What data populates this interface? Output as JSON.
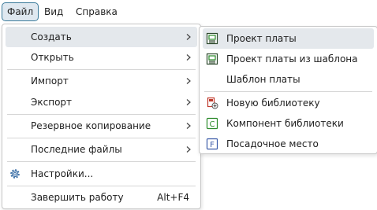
{
  "menubar": {
    "items": [
      {
        "label": "Файл"
      },
      {
        "label": "Вид"
      },
      {
        "label": "Справка"
      }
    ]
  },
  "file_menu": {
    "items": [
      {
        "label": "Создать"
      },
      {
        "label": "Открыть"
      },
      {
        "label": "Импорт"
      },
      {
        "label": "Экспорт"
      },
      {
        "label": "Резервное копирование"
      },
      {
        "label": "Последние файлы"
      },
      {
        "label": "Настройки..."
      },
      {
        "label": "Завершить работу",
        "shortcut": "Alt+F4"
      }
    ]
  },
  "create_submenu": {
    "items": [
      {
        "label": "Проект платы",
        "icon": "board-project-icon"
      },
      {
        "label": "Проект платы из шаблона",
        "icon": "board-template-icon"
      },
      {
        "label": "Шаблон платы"
      },
      {
        "label": "Новую библиотеку",
        "icon": "new-library-icon"
      },
      {
        "label": "Компонент библиотеки",
        "icon": "component-icon"
      },
      {
        "label": "Посадочное место",
        "icon": "footprint-icon"
      }
    ]
  },
  "colors": {
    "accent_border": "#3a7a9a",
    "hover_bg": "#e4e8ec",
    "component_icon": "#2a8a2a",
    "footprint_icon": "#3a5aa8",
    "library_icon": "#c0392b"
  }
}
